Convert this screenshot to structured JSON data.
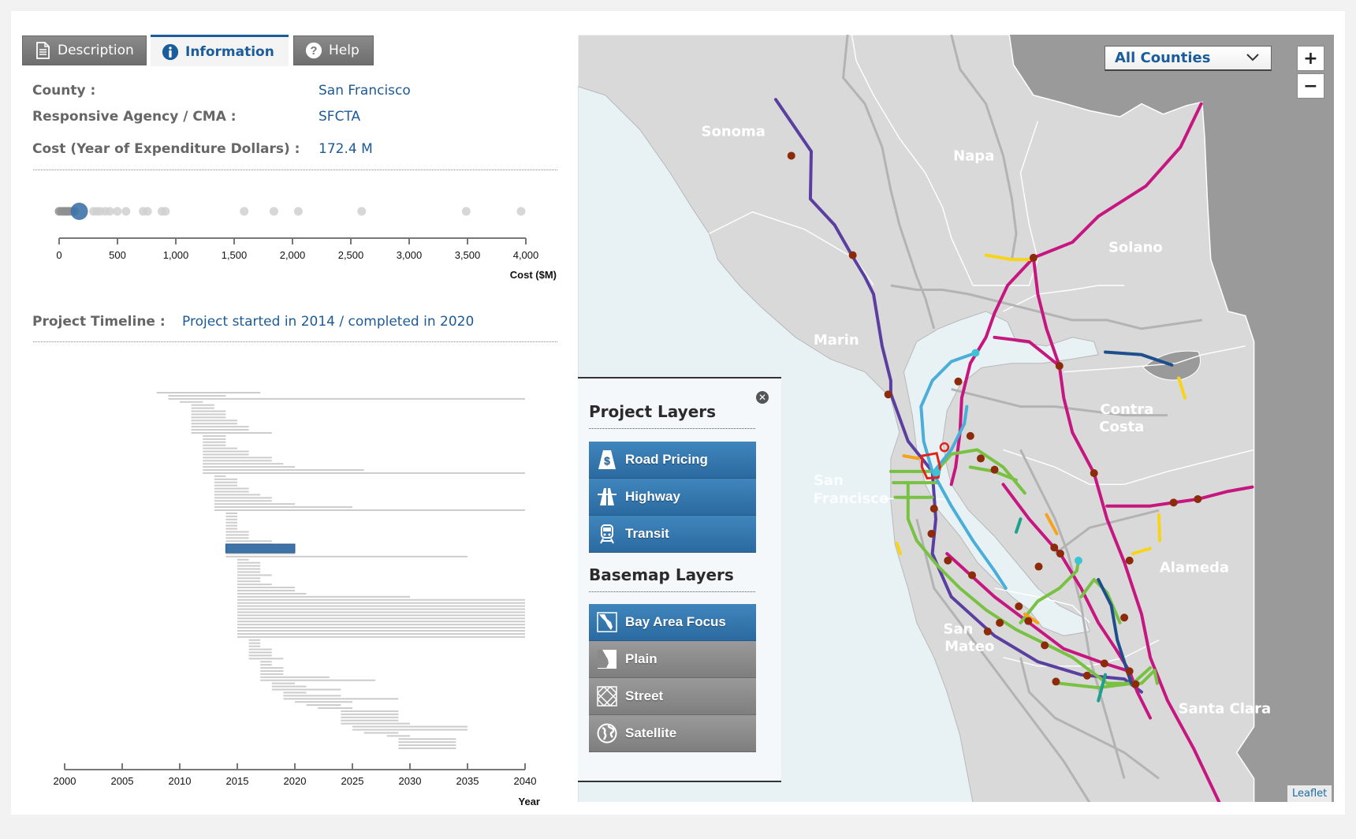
{
  "tabs": [
    {
      "label": "Description",
      "icon": "document-icon",
      "active": false
    },
    {
      "label": "Information",
      "icon": "info-icon",
      "active": true
    },
    {
      "label": "Help",
      "icon": "help-icon",
      "active": false
    }
  ],
  "info": {
    "county_label": "County :",
    "county_value": "San Francisco",
    "agency_label": "Responsive Agency / CMA :",
    "agency_value": "SFCTA",
    "cost_label": "Cost (Year of Expenditure Dollars) :",
    "cost_value": "172.4 M",
    "timeline_label": "Project Timeline :",
    "timeline_value": "Project started in 2014 / completed in 2020"
  },
  "chart_data": [
    {
      "type": "scatter",
      "title": "",
      "xlabel": "Cost ($M)",
      "ylabel": "",
      "xlim": [
        0,
        4000
      ],
      "xticks": [
        0,
        500,
        1000,
        1500,
        2000,
        2500,
        3000,
        3500,
        4000
      ],
      "xtick_labels": [
        "0",
        "500",
        "1,000",
        "1,500",
        "2,000",
        "2,500",
        "3,000",
        "3,500",
        "4,000"
      ],
      "grid": false,
      "values": [
        0,
        20,
        40,
        53,
        70,
        88,
        110,
        132,
        294,
        323,
        352,
        396,
        435,
        499,
        573,
        720,
        758,
        881,
        911,
        1586,
        1841,
        2050,
        2593,
        3489,
        3959
      ],
      "highlight": 172.4,
      "colors": {
        "point": "#bdbdbd",
        "highlight": "#3d73a8"
      }
    },
    {
      "type": "bar",
      "orientation": "horizontal-range",
      "title": "",
      "xlabel": "Year",
      "ylabel": "",
      "xlim": [
        2000,
        2040
      ],
      "xticks": [
        2000,
        2005,
        2010,
        2015,
        2020,
        2025,
        2030,
        2035,
        2040
      ],
      "xtick_labels": [
        "2000",
        "2005",
        "2010",
        "2015",
        "2020",
        "2025",
        "2030",
        "2035",
        "2040"
      ],
      "grid": false,
      "highlight": {
        "start": 2014,
        "end": 2020
      },
      "colors": {
        "bar": "#cccccc",
        "highlight": "#3d73a8"
      },
      "series": [
        {
          "start": 2008,
          "end": 2017
        },
        {
          "start": 2009,
          "end": 2014
        },
        {
          "start": 2009,
          "end": 2040
        },
        {
          "start": 2010,
          "end": 2012
        },
        {
          "start": 2011,
          "end": 2013
        },
        {
          "start": 2011,
          "end": 2013
        },
        {
          "start": 2011,
          "end": 2014
        },
        {
          "start": 2011,
          "end": 2014
        },
        {
          "start": 2011,
          "end": 2014
        },
        {
          "start": 2011,
          "end": 2015
        },
        {
          "start": 2011,
          "end": 2015
        },
        {
          "start": 2011,
          "end": 2016
        },
        {
          "start": 2011,
          "end": 2016
        },
        {
          "start": 2011,
          "end": 2018
        },
        {
          "start": 2012,
          "end": 2014
        },
        {
          "start": 2012,
          "end": 2014
        },
        {
          "start": 2012,
          "end": 2014
        },
        {
          "start": 2012,
          "end": 2014
        },
        {
          "start": 2012,
          "end": 2015
        },
        {
          "start": 2012,
          "end": 2016
        },
        {
          "start": 2012,
          "end": 2016
        },
        {
          "start": 2012,
          "end": 2018
        },
        {
          "start": 2012,
          "end": 2018
        },
        {
          "start": 2012,
          "end": 2019
        },
        {
          "start": 2012,
          "end": 2020
        },
        {
          "start": 2012,
          "end": 2026
        },
        {
          "start": 2012,
          "end": 2040
        },
        {
          "start": 2013,
          "end": 2014
        },
        {
          "start": 2013,
          "end": 2015
        },
        {
          "start": 2013,
          "end": 2015
        },
        {
          "start": 2013,
          "end": 2015
        },
        {
          "start": 2013,
          "end": 2016
        },
        {
          "start": 2013,
          "end": 2016
        },
        {
          "start": 2013,
          "end": 2017
        },
        {
          "start": 2013,
          "end": 2018
        },
        {
          "start": 2013,
          "end": 2018
        },
        {
          "start": 2013,
          "end": 2020
        },
        {
          "start": 2013,
          "end": 2025
        },
        {
          "start": 2013,
          "end": 2040
        },
        {
          "start": 2014,
          "end": 2015
        },
        {
          "start": 2014,
          "end": 2015
        },
        {
          "start": 2014,
          "end": 2015
        },
        {
          "start": 2014,
          "end": 2015
        },
        {
          "start": 2014,
          "end": 2015
        },
        {
          "start": 2014,
          "end": 2015
        },
        {
          "start": 2014,
          "end": 2016
        },
        {
          "start": 2014,
          "end": 2016
        },
        {
          "start": 2014,
          "end": 2016
        },
        {
          "start": 2014,
          "end": 2018
        },
        {
          "start": 2014,
          "end": 2018
        },
        {
          "start": 2014,
          "end": 2019
        },
        {
          "start": 2014,
          "end": 2020
        },
        {
          "start": 2014,
          "end": 2020
        },
        {
          "start": 2014,
          "end": 2035
        },
        {
          "start": 2015,
          "end": 2016
        },
        {
          "start": 2015,
          "end": 2017
        },
        {
          "start": 2015,
          "end": 2017
        },
        {
          "start": 2015,
          "end": 2017
        },
        {
          "start": 2015,
          "end": 2017
        },
        {
          "start": 2015,
          "end": 2018
        },
        {
          "start": 2015,
          "end": 2017
        },
        {
          "start": 2015,
          "end": 2017
        },
        {
          "start": 2015,
          "end": 2018
        },
        {
          "start": 2015,
          "end": 2020
        },
        {
          "start": 2015,
          "end": 2020
        },
        {
          "start": 2015,
          "end": 2021
        },
        {
          "start": 2015,
          "end": 2030
        },
        {
          "start": 2015,
          "end": 2040
        },
        {
          "start": 2015,
          "end": 2040
        },
        {
          "start": 2015,
          "end": 2040
        },
        {
          "start": 2015,
          "end": 2040
        },
        {
          "start": 2015,
          "end": 2040
        },
        {
          "start": 2015,
          "end": 2040
        },
        {
          "start": 2015,
          "end": 2040
        },
        {
          "start": 2015,
          "end": 2040
        },
        {
          "start": 2015,
          "end": 2040
        },
        {
          "start": 2015,
          "end": 2040
        },
        {
          "start": 2015,
          "end": 2040
        },
        {
          "start": 2015,
          "end": 2040
        },
        {
          "start": 2015,
          "end": 2040
        },
        {
          "start": 2016,
          "end": 2017
        },
        {
          "start": 2016,
          "end": 2017
        },
        {
          "start": 2016,
          "end": 2017
        },
        {
          "start": 2016,
          "end": 2018
        },
        {
          "start": 2016,
          "end": 2018
        },
        {
          "start": 2016,
          "end": 2018
        },
        {
          "start": 2016,
          "end": 2019
        },
        {
          "start": 2017,
          "end": 2018
        },
        {
          "start": 2017,
          "end": 2018
        },
        {
          "start": 2017,
          "end": 2019
        },
        {
          "start": 2017,
          "end": 2019
        },
        {
          "start": 2017,
          "end": 2019
        },
        {
          "start": 2017,
          "end": 2023
        },
        {
          "start": 2017,
          "end": 2027
        },
        {
          "start": 2018,
          "end": 2020
        },
        {
          "start": 2018,
          "end": 2021
        },
        {
          "start": 2018,
          "end": 2024
        },
        {
          "start": 2019,
          "end": 2021
        },
        {
          "start": 2019,
          "end": 2024
        },
        {
          "start": 2019,
          "end": 2029
        },
        {
          "start": 2020,
          "end": 2025
        },
        {
          "start": 2021,
          "end": 2024
        },
        {
          "start": 2022,
          "end": 2025
        },
        {
          "start": 2024,
          "end": 2029
        },
        {
          "start": 2024,
          "end": 2029
        },
        {
          "start": 2024,
          "end": 2029
        },
        {
          "start": 2024,
          "end": 2029
        },
        {
          "start": 2024,
          "end": 2030
        },
        {
          "start": 2025,
          "end": 2035
        },
        {
          "start": 2025,
          "end": 2035
        },
        {
          "start": 2026,
          "end": 2029
        },
        {
          "start": 2028,
          "end": 2030
        },
        {
          "start": 2029,
          "end": 2034
        },
        {
          "start": 2029,
          "end": 2034
        },
        {
          "start": 2029,
          "end": 2034
        },
        {
          "start": 2029,
          "end": 2034
        }
      ]
    }
  ],
  "map": {
    "county_select": {
      "selected": "All Counties"
    },
    "zoom_in": "+",
    "zoom_out": "−",
    "attribution": "Leaflet",
    "county_labels": [
      {
        "name": "Sonoma"
      },
      {
        "name": "Napa"
      },
      {
        "name": "Solano"
      },
      {
        "name": "Marin"
      },
      {
        "name": "Contra Costa"
      },
      {
        "name": "San Francisco"
      },
      {
        "name": "Alameda"
      },
      {
        "name": "San Mateo"
      },
      {
        "name": "Santa Clara"
      }
    ],
    "colors": {
      "land": "#d9d9d9",
      "outside": "#9a9a9a",
      "water": "#e8f2f5",
      "road": "#b3b3b3",
      "smart_rail": "#5b3fa0",
      "express_lanes": "#c6167f",
      "bus": "#79c142",
      "ferry": "#4aaed8",
      "rail": "#1f4e8c",
      "highway": "#f7d417",
      "interchange": "#f7a21b",
      "selected": "#e2231a",
      "teal": "#1fa08a",
      "point": "#8b2b0a",
      "point_cyan": "#3cc4d6"
    }
  },
  "legend": {
    "project_title": "Project Layers",
    "project_layers": [
      {
        "label": "Road Pricing",
        "icon": "road-pricing-icon"
      },
      {
        "label": "Highway",
        "icon": "highway-icon"
      },
      {
        "label": "Transit",
        "icon": "train-icon"
      }
    ],
    "basemap_title": "Basemap Layers",
    "basemap_layers": [
      {
        "label": "Bay Area Focus",
        "icon": "bay-area-map-icon",
        "active": true
      },
      {
        "label": "Plain",
        "icon": "plain-map-icon",
        "active": false
      },
      {
        "label": "Street",
        "icon": "street-grid-icon",
        "active": false
      },
      {
        "label": "Satellite",
        "icon": "globe-icon",
        "active": false
      }
    ]
  }
}
